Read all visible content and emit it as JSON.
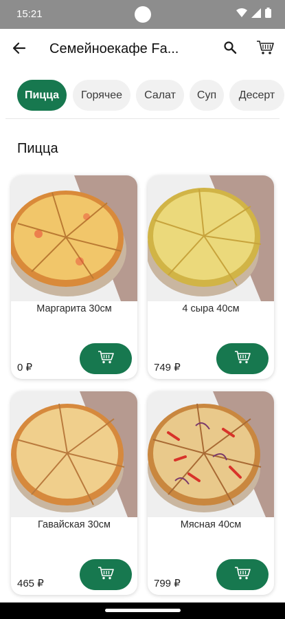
{
  "status_bar": {
    "time": "15:21"
  },
  "app_bar": {
    "title": "Семейноекафе Fa..."
  },
  "tabs": [
    {
      "label": "Пицца",
      "active": true
    },
    {
      "label": "Горячее",
      "active": false
    },
    {
      "label": "Салат",
      "active": false
    },
    {
      "label": "Суп",
      "active": false
    },
    {
      "label": "Десерт",
      "active": false
    }
  ],
  "section": {
    "title": "Пицца"
  },
  "products": [
    {
      "name": "Маргарита 30см",
      "price": "0 ₽"
    },
    {
      "name": "4 сыра 40см",
      "price": "749 ₽"
    },
    {
      "name": "Гавайская 30см",
      "price": "465 ₽"
    },
    {
      "name": "Мясная 40см",
      "price": "799 ₽"
    }
  ],
  "colors": {
    "accent": "#17784f",
    "status_bar": "#8d8d8d",
    "tab_inactive": "#f1f1f1"
  },
  "icons": {
    "back": "arrow-left-icon",
    "search": "search-icon",
    "cart": "cart-icon",
    "add_to_cart": "cart-plus-icon"
  }
}
